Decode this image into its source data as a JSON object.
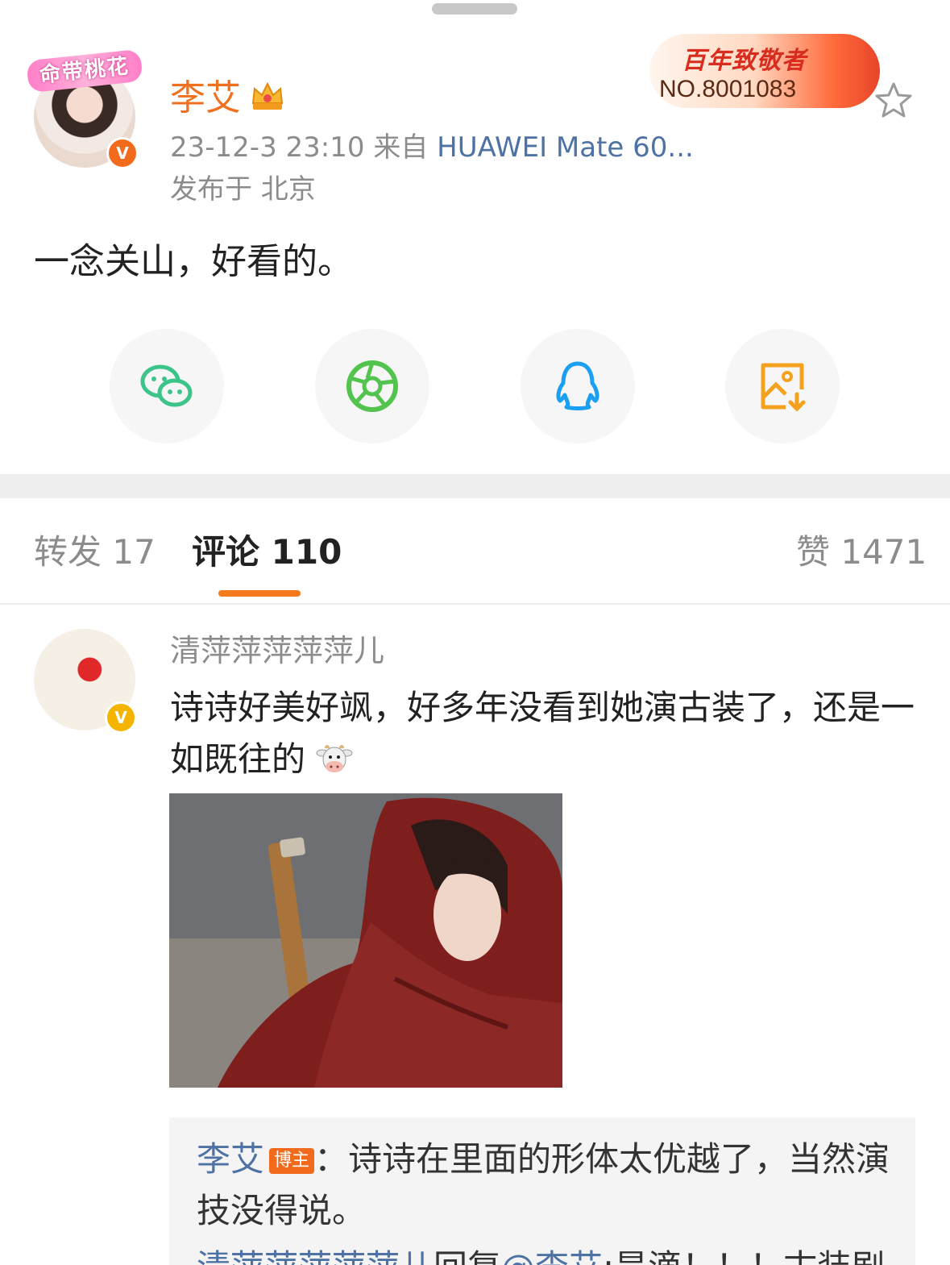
{
  "post": {
    "author_name": "李艾",
    "avatar_frame_text": "命带桃花",
    "timestamp": "23-12-3 23:10",
    "source_prefix": "来自",
    "source_device": "HUAWEI Mate 60...",
    "location": "发布于 北京",
    "content": "一念关山，好看的。",
    "fan_badge": {
      "title": "百年致敬者",
      "number": "NO.8001083"
    }
  },
  "share_targets": [
    {
      "name": "wechat",
      "icon": "wechat-icon",
      "color": "#3cc48b"
    },
    {
      "name": "moments",
      "icon": "moments-aperture-icon",
      "color": "#52c44e"
    },
    {
      "name": "qq",
      "icon": "qq-penguin-icon",
      "color": "#1a9ff2"
    },
    {
      "name": "save-image",
      "icon": "save-image-icon",
      "color": "#f4a21d"
    }
  ],
  "tabs": {
    "repost": "转发 17",
    "comments": "评论 110",
    "likes": "赞 1471",
    "active_color": "#f37b1d"
  },
  "comment": {
    "user_name": "清萍萍萍萍萍儿",
    "text": "诗诗好美好飒，好多年没看到她演古装了，还是一如既往的",
    "emoji": "cow-emoji",
    "reply": {
      "name": "李艾",
      "badge": "博主",
      "text": "：诗诗在里面的形体太优越了，当然演技没得说。"
    },
    "reply2": {
      "name": "清萍萍萍萍萍儿",
      "action": "回复",
      "mention": "@李艾",
      "text": ":是滴！！！古装剧"
    }
  }
}
